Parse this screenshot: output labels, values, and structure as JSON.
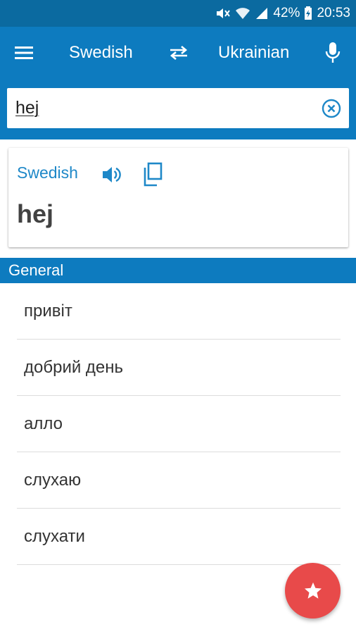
{
  "status_bar": {
    "battery": "42%",
    "time": "20:53"
  },
  "app_bar": {
    "source_language": "Swedish",
    "target_language": "Ukrainian"
  },
  "search": {
    "value": "hej"
  },
  "card": {
    "language": "Swedish",
    "word": "hej"
  },
  "section": {
    "title": "General"
  },
  "results": [
    {
      "text": "привіт"
    },
    {
      "text": "добрий день"
    },
    {
      "text": "алло"
    },
    {
      "text": "слухаю"
    },
    {
      "text": "слухати"
    }
  ],
  "colors": {
    "status_bar": "#0b6aa0",
    "primary": "#0d7bbf",
    "accent_text": "#1e88c8",
    "fab": "#e84a4a"
  },
  "icons": {
    "menu": "menu-icon",
    "swap": "swap-icon",
    "mic": "microphone-icon",
    "clear": "clear-icon",
    "speaker": "speaker-icon",
    "copy": "copy-icon",
    "favorite": "star-icon"
  }
}
